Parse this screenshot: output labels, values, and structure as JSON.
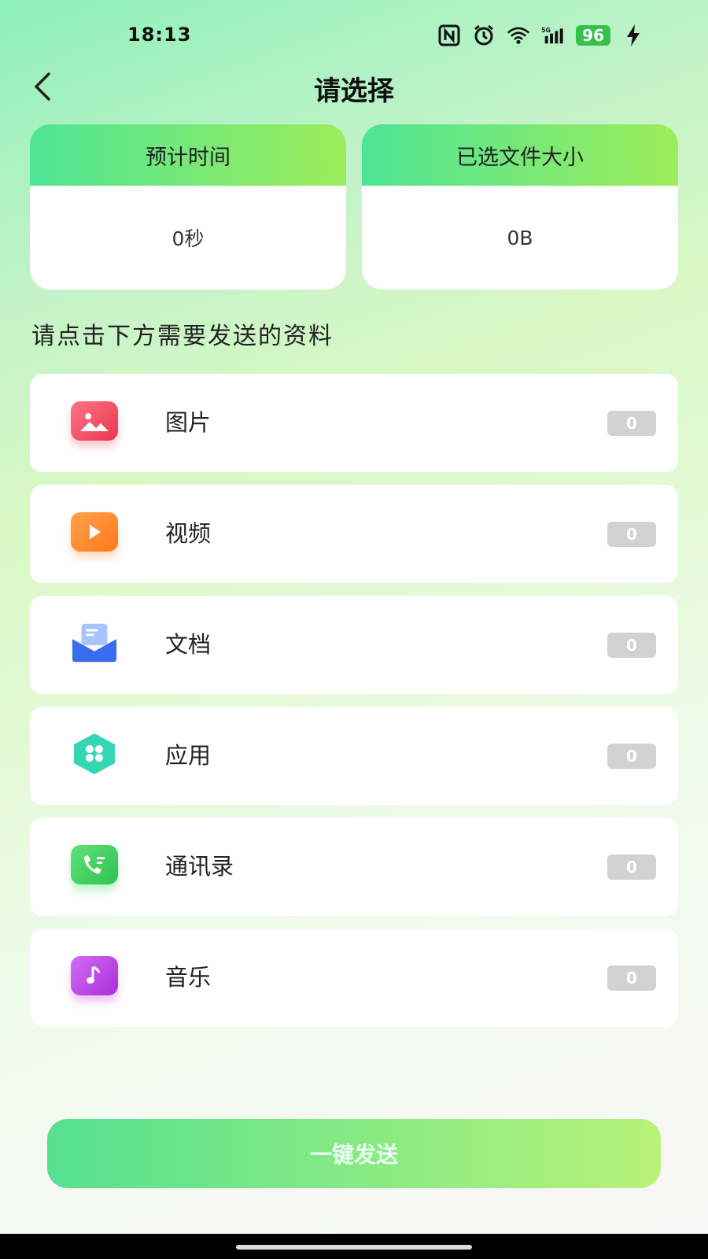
{
  "status_bar": {
    "time": "18:13",
    "battery_level": "96",
    "network": "5G",
    "icons": [
      "nfc-icon",
      "alarm-icon",
      "wifi-icon",
      "signal-icon",
      "battery-icon",
      "charging-icon"
    ]
  },
  "header": {
    "title": "请选择",
    "back_icon": "chevron-left-icon"
  },
  "summary": {
    "time_label": "预计时间",
    "time_value": "0秒",
    "size_label": "已选文件大小",
    "size_value": "0B"
  },
  "hint": "请点击下方需要发送的资料",
  "categories": [
    {
      "label": "图片",
      "count": "0",
      "icon": "image-icon",
      "color": "#f0506a"
    },
    {
      "label": "视频",
      "count": "0",
      "icon": "video-play-icon",
      "color": "#ff8a2a"
    },
    {
      "label": "文档",
      "count": "0",
      "icon": "document-envelope-icon",
      "color": "#3a6cf0"
    },
    {
      "label": "应用",
      "count": "0",
      "icon": "app-hexagon-icon",
      "color": "#36d6b5"
    },
    {
      "label": "通讯录",
      "count": "0",
      "icon": "contacts-phone-icon",
      "color": "#3fd35f"
    },
    {
      "label": "音乐",
      "count": "0",
      "icon": "music-note-icon",
      "color": "#c046e8"
    }
  ],
  "send_button": "一键发送",
  "colors": {
    "accent_start": "#4fe496",
    "accent_end": "#9ded5a",
    "badge_bg": "#d2d2d2"
  }
}
